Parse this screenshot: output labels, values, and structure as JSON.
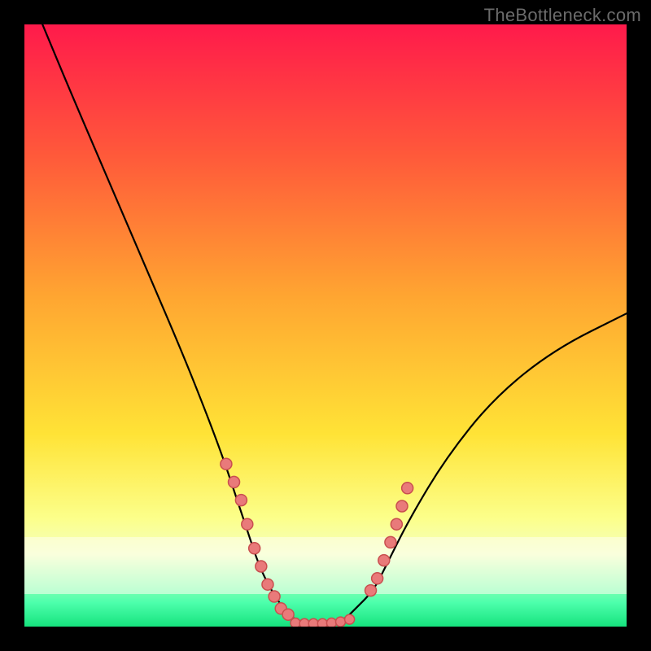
{
  "watermark": "TheBottleneck.com",
  "chart_data": {
    "type": "line",
    "title": "",
    "xlabel": "",
    "ylabel": "",
    "xlim": [
      0,
      100
    ],
    "ylim": [
      0,
      100
    ],
    "grid": false,
    "legend": false,
    "curve": {
      "name": "bottleneck-curve",
      "x": [
        3,
        8,
        14,
        20,
        26,
        30,
        33,
        35,
        37,
        39,
        41,
        43,
        45,
        47,
        50,
        53,
        55,
        58,
        60,
        64,
        70,
        78,
        88,
        100
      ],
      "y": [
        100,
        88,
        74,
        60,
        46,
        36,
        28,
        22,
        16,
        10,
        6,
        3,
        1,
        0.5,
        0.5,
        1,
        3,
        6,
        10,
        18,
        28,
        38,
        46,
        52
      ]
    },
    "series": [
      {
        "name": "left-cluster",
        "x": [
          33.5,
          34.8,
          36.0,
          37.0,
          38.2,
          39.3,
          40.4,
          41.5,
          42.6,
          43.8
        ],
        "y": [
          27,
          24,
          21,
          17,
          13,
          10,
          7,
          5,
          3,
          2
        ]
      },
      {
        "name": "trough-cluster",
        "x": [
          45.0,
          46.5,
          48.0,
          49.5,
          51.0,
          52.5,
          54.0
        ],
        "y": [
          0.6,
          0.5,
          0.5,
          0.5,
          0.6,
          0.8,
          1.2
        ]
      },
      {
        "name": "right-cluster",
        "x": [
          57.5,
          58.6,
          59.7,
          60.8,
          61.8,
          62.7,
          63.6
        ],
        "y": [
          6,
          8,
          11,
          14,
          17,
          20,
          23
        ]
      }
    ],
    "gradient_stops": [
      {
        "pos": 0.0,
        "color": "#ff1a4b"
      },
      {
        "pos": 0.22,
        "color": "#ff5a3a"
      },
      {
        "pos": 0.45,
        "color": "#ffa531"
      },
      {
        "pos": 0.68,
        "color": "#ffe336"
      },
      {
        "pos": 0.82,
        "color": "#fcff8a"
      },
      {
        "pos": 0.88,
        "color": "#f3ffc0"
      },
      {
        "pos": 0.96,
        "color": "#4dffac"
      },
      {
        "pos": 1.0,
        "color": "#16e37e"
      }
    ]
  }
}
